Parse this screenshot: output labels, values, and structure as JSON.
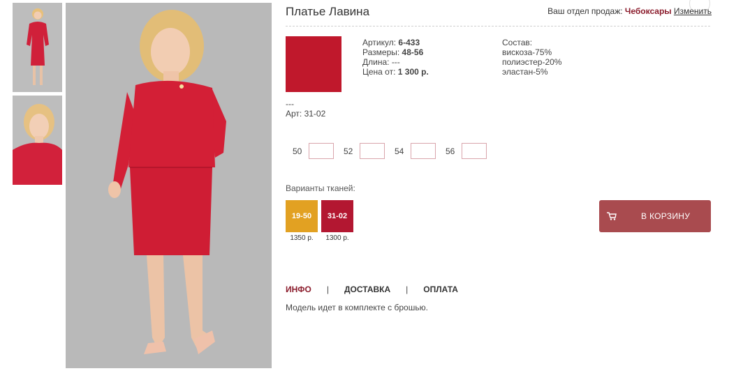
{
  "product": {
    "title": "Платье Лавина",
    "region_prefix": "Ваш отдел продаж:",
    "region_city": "Чебоксары",
    "region_change": "Изменить",
    "main_color": "#c0182c"
  },
  "specs": {
    "article_label": "Артикул:",
    "article_value": "6-433",
    "sizes_label": "Размеры:",
    "sizes_value": "48-56",
    "length_label": "Длина:",
    "length_value": "---",
    "price_label": "Цена от:",
    "price_value": "1 300 р."
  },
  "composition": {
    "label": "Состав:",
    "items": [
      "вискоза-75%",
      "полиэстер-20%",
      "эластан-5%"
    ]
  },
  "art": {
    "dash": "---",
    "code": "Арт: 31-02"
  },
  "sizes": [
    {
      "label": "50",
      "value": ""
    },
    {
      "label": "52",
      "value": ""
    },
    {
      "label": "54",
      "value": ""
    },
    {
      "label": "56",
      "value": ""
    }
  ],
  "fabrics": {
    "label": "Варианты тканей:",
    "items": [
      {
        "code": "19-50",
        "price": "1350 р.",
        "color": "#e2a122"
      },
      {
        "code": "31-02",
        "price": "1300 р.",
        "color": "#b31731"
      }
    ]
  },
  "cart": {
    "label": "В КОРЗИНУ",
    "icon": "cart-icon",
    "color": "#a94b4f"
  },
  "tabs": [
    {
      "label": "ИНФО",
      "active": true
    },
    {
      "label": "ДОСТАВКА",
      "active": false
    },
    {
      "label": "ОПЛАТА",
      "active": false
    }
  ],
  "tab_separator": "|",
  "description": "Модель идет в комплекте с брошью.",
  "colors": {
    "accent": "#8b1c2c",
    "input_border": "#d9a4ab"
  }
}
